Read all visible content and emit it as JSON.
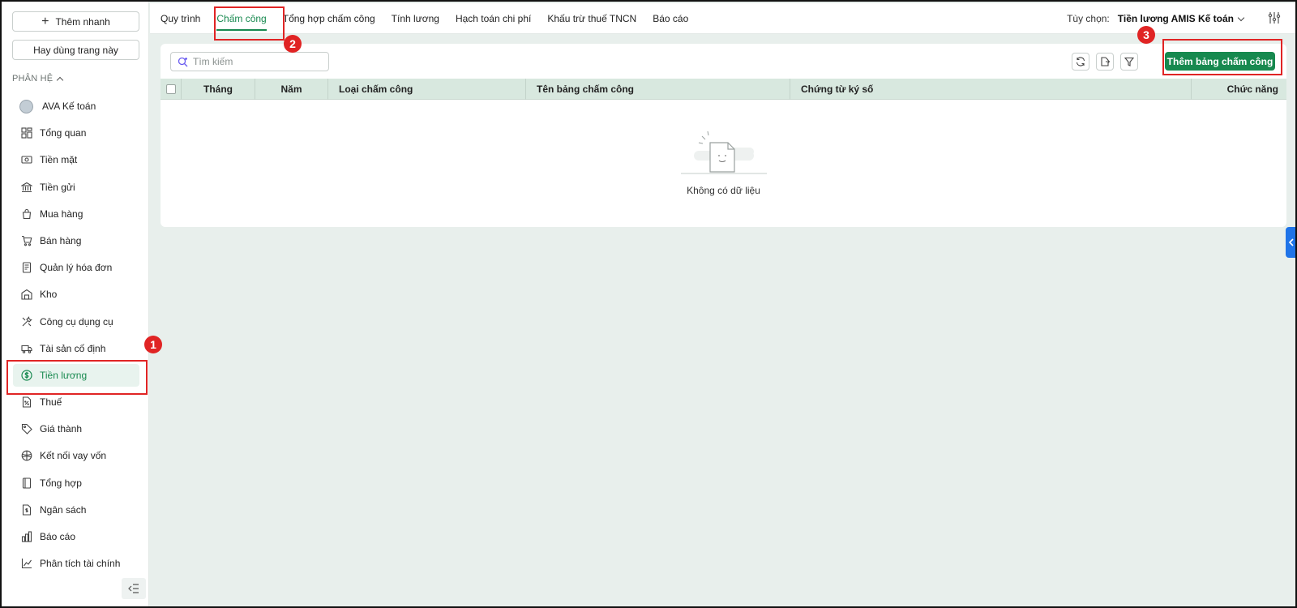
{
  "sidebar": {
    "quick_add_label": "Thêm nhanh",
    "frequent_label": "Hay dùng trang này",
    "section_label": "PHÂN HỆ",
    "items": [
      {
        "label": "AVA Kế toán",
        "icon": "ava-avatar-icon"
      },
      {
        "label": "Tổng quan",
        "icon": "dashboard-icon"
      },
      {
        "label": "Tiền mặt",
        "icon": "cash-icon"
      },
      {
        "label": "Tiền gửi",
        "icon": "bank-icon"
      },
      {
        "label": "Mua hàng",
        "icon": "shopping-bag-icon"
      },
      {
        "label": "Bán hàng",
        "icon": "cart-icon"
      },
      {
        "label": "Quản lý hóa đơn",
        "icon": "invoice-icon"
      },
      {
        "label": "Kho",
        "icon": "warehouse-icon"
      },
      {
        "label": "Công cụ dụng cụ",
        "icon": "tools-icon"
      },
      {
        "label": "Tài sản cố định",
        "icon": "truck-icon"
      },
      {
        "label": "Tiền lương",
        "icon": "dollar-circle-icon"
      },
      {
        "label": "Thuế",
        "icon": "tax-document-icon"
      },
      {
        "label": "Giá thành",
        "icon": "price-tag-icon"
      },
      {
        "label": "Kết nối vay vốn",
        "icon": "loan-connect-icon"
      },
      {
        "label": "Tổng hợp",
        "icon": "book-icon"
      },
      {
        "label": "Ngân sách",
        "icon": "budget-icon"
      },
      {
        "label": "Báo cáo",
        "icon": "bar-chart-icon"
      },
      {
        "label": "Phân tích tài chính",
        "icon": "analytics-icon"
      }
    ],
    "active_item": "Tiền lương"
  },
  "topbar": {
    "tabs": [
      {
        "label": "Quy trình"
      },
      {
        "label": "Chấm công"
      },
      {
        "label": "Tổng hợp chấm công"
      },
      {
        "label": "Tính lương"
      },
      {
        "label": "Hạch toán chi phí"
      },
      {
        "label": "Khấu trừ thuế TNCN"
      },
      {
        "label": "Báo cáo"
      }
    ],
    "active_tab": "Chấm công",
    "option_label": "Tùy chọn:",
    "option_value": "Tiền lương AMIS Kế toán"
  },
  "toolbar": {
    "search_placeholder": "Tìm kiếm",
    "add_button_label": "Thêm bảng chấm công"
  },
  "table": {
    "columns": [
      "Tháng",
      "Năm",
      "Loại chấm công",
      "Tên bảng chấm công",
      "Chứng từ ký số",
      "Chức năng"
    ],
    "rows": [],
    "empty_text": "Không có dữ liệu"
  },
  "annotations": {
    "step1": "1",
    "step2": "2",
    "step3": "3",
    "highlight_color": "#e02424"
  },
  "colors": {
    "accent": "#17894f",
    "header_bg": "#d8e8df",
    "page_bg": "#e8efec",
    "side_tab": "#1f74e8"
  }
}
